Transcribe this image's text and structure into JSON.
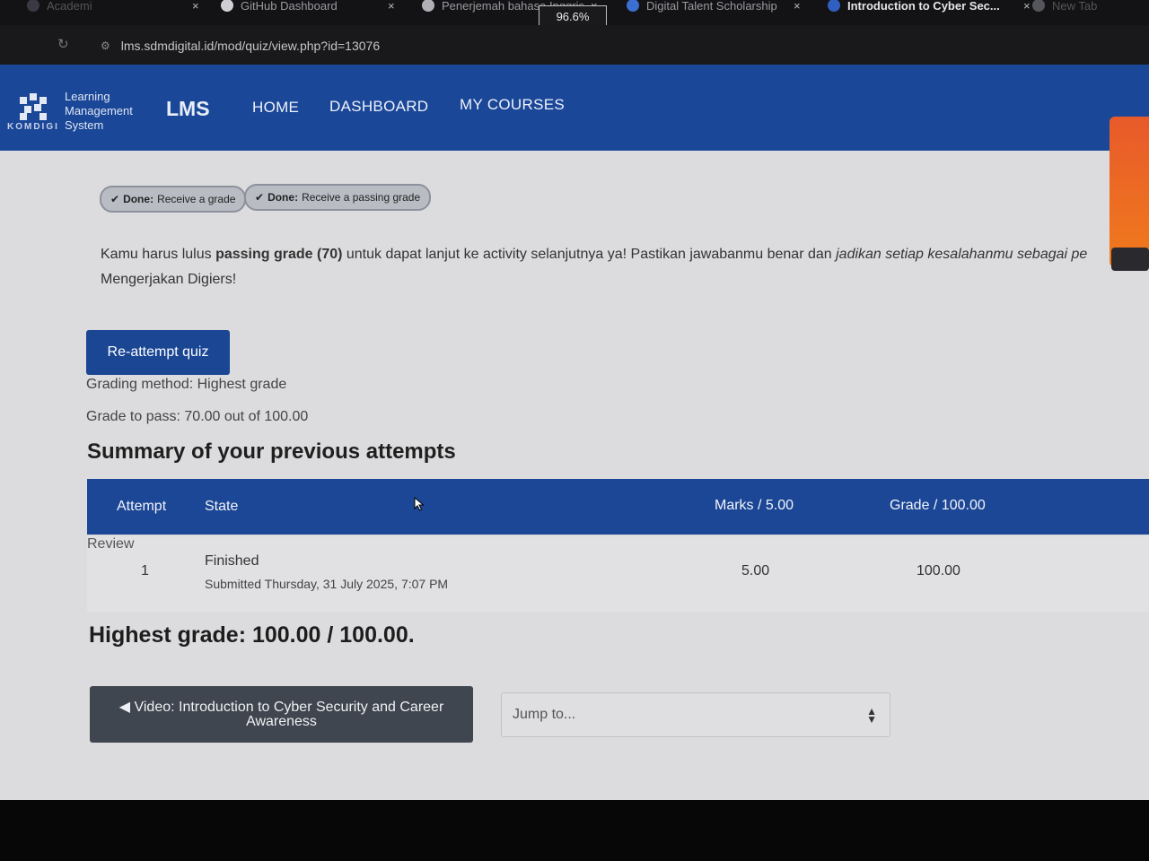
{
  "browser": {
    "tabs": [
      {
        "label": "Academi",
        "close": "×"
      },
      {
        "label": "GitHub Dashboard",
        "close": "×"
      },
      {
        "label": "Penerjemah bahasa Inggris",
        "close": "×"
      },
      {
        "label": "Digital Talent Scholarship",
        "close": "×"
      },
      {
        "label": "Introduction to Cyber Sec...",
        "close": "×"
      },
      {
        "label": "New Tab",
        "close": ""
      }
    ],
    "zoom_popup": "96.6%",
    "url": "lms.sdmdigital.id/mod/quiz/view.php?id=13076",
    "reload_glyph": "↻",
    "site_info_glyph": "⚙"
  },
  "navbar": {
    "brand_org": "KOMDIGI",
    "brand_lines": [
      "Learning",
      "Management",
      "System"
    ],
    "brand_short": "LMS",
    "links": [
      "HOME",
      "DASHBOARD",
      "MY COURSES"
    ]
  },
  "completion_badges": [
    {
      "prefix": "Done:",
      "text": "Receive a grade"
    },
    {
      "prefix": "Done:",
      "text": "Receive a passing grade"
    }
  ],
  "intro": {
    "line1_a": "Kamu harus lulus ",
    "line1_bold": "passing grade (70)",
    "line1_b": " untuk dapat lanjut ke activity selanjutnya ya! Pastikan jawabanmu benar dan ",
    "line1_italic": "jadikan setiap kesalahanmu sebagai pe",
    "line2": "Mengerjakan Digiers!"
  },
  "actions": {
    "reattempt_label": "Re-attempt quiz"
  },
  "quiz_info": {
    "grading_method": "Grading method: Highest grade",
    "grade_to_pass": "Grade to pass: 70.00 out of 100.00"
  },
  "summary": {
    "heading": "Summary of your previous attempts",
    "columns": [
      "Attempt",
      "State",
      "Marks / 5.00",
      "Grade / 100.00"
    ],
    "rows": [
      {
        "attempt": "1",
        "state": "Finished",
        "submitted": "Submitted Thursday, 31 July 2025, 7:07 PM",
        "marks": "5.00",
        "grade": "100.00",
        "review": "Review"
      }
    ]
  },
  "highest_grade": "Highest grade: 100.00 / 100.00.",
  "navigation": {
    "prev_activity_line1": "◀ Video: Introduction to Cyber Security and Career",
    "prev_activity_line2": "Awareness",
    "jump_placeholder": "Jump to..."
  }
}
